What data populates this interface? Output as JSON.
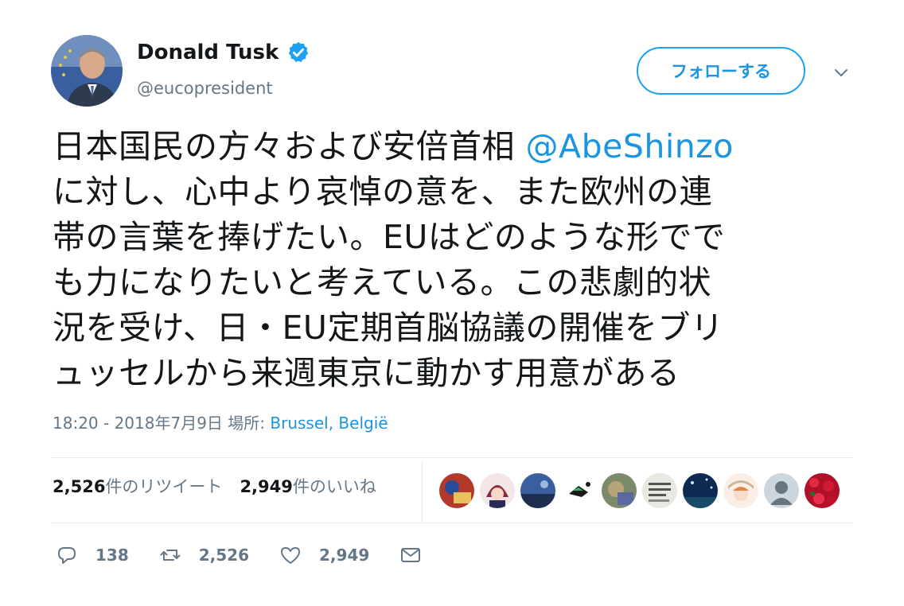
{
  "author": {
    "name": "Donald Tusk",
    "handle": "@eucopresident"
  },
  "follow_label": "フォローする",
  "tweet": {
    "line1_text": "日本国民の方々および安倍首相 ",
    "mention": "@AbeShinzo",
    "line2": "に対し、心中より哀悼の意を、また欧州の連",
    "line3": "帯の言葉を捧げたい。EUはどのような形でで",
    "line4": "も力になりたいと考えている。この悲劇的状",
    "line5": "況を受け、日・EU定期首脳協議の開催をブリ",
    "line6": "ュッセルから来週東京に動かす用意がある"
  },
  "meta": {
    "time_date": "18:20 - 2018年7月9日",
    "place_label": "場所: ",
    "place": "Brussel, België"
  },
  "stats": {
    "retweets_count": "2,526",
    "retweets_label": "件のリツイート",
    "likes_count": "2,949",
    "likes_label": "件のいいね"
  },
  "actions": {
    "replies": "138",
    "retweets": "2,526",
    "likes": "2,949"
  },
  "colors": {
    "accent": "#1da1f2",
    "link": "#1b95e0",
    "muted": "#657786"
  }
}
